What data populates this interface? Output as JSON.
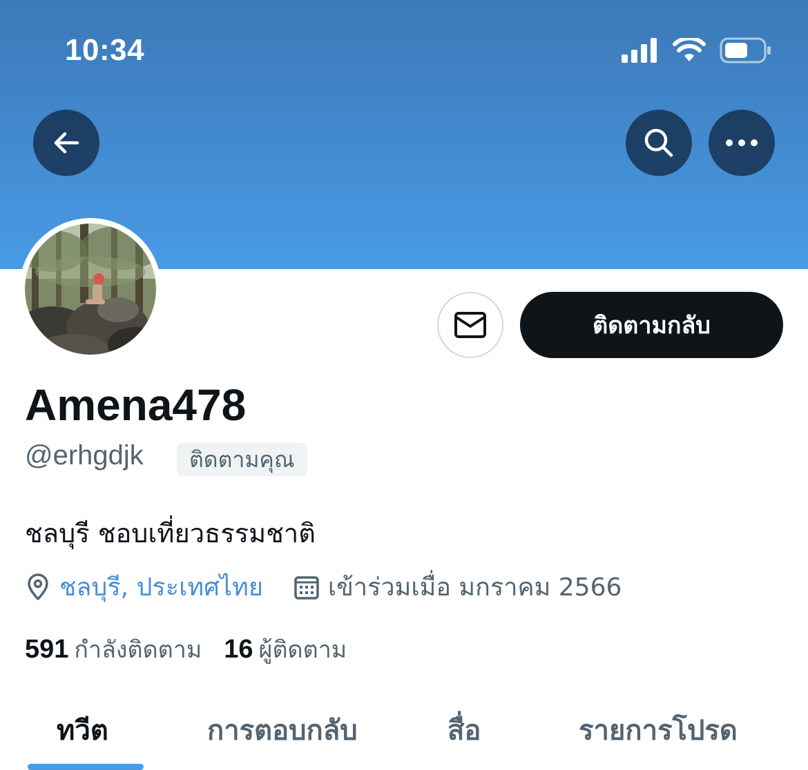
{
  "status_bar": {
    "time": "10:34"
  },
  "header": {
    "back_icon": "arrow-left-icon",
    "search_icon": "search-icon",
    "more_icon": "more-horizontal-icon",
    "banner_color": "#4a9ae6"
  },
  "profile": {
    "display_name": "Amena478",
    "handle": "@erhgdjk",
    "follows_you_badge": "ติดตามคุณ",
    "bio": "ชลบุรี ชอบเที่ยวธรรมชาติ",
    "location": "ชลบุรี, ประเทศไทย",
    "joined": "เข้าร่วมเมื่อ มกราคม 2566",
    "following_count": "591",
    "following_label": "กำลังติดตาม",
    "followers_count": "16",
    "followers_label": "ผู้ติดตาม"
  },
  "actions": {
    "message_icon": "envelope-icon",
    "follow_back_label": "ติดตามกลับ"
  },
  "tabs": [
    {
      "label": "ทวีต",
      "active": true
    },
    {
      "label": "การตอบกลับ",
      "active": false
    },
    {
      "label": "สื่อ",
      "active": false
    },
    {
      "label": "รายการโปรด",
      "active": false
    }
  ],
  "colors": {
    "accent": "#4a9ae6",
    "link": "#4a8ed6",
    "text_primary": "#0f1419",
    "text_secondary": "#536471"
  }
}
